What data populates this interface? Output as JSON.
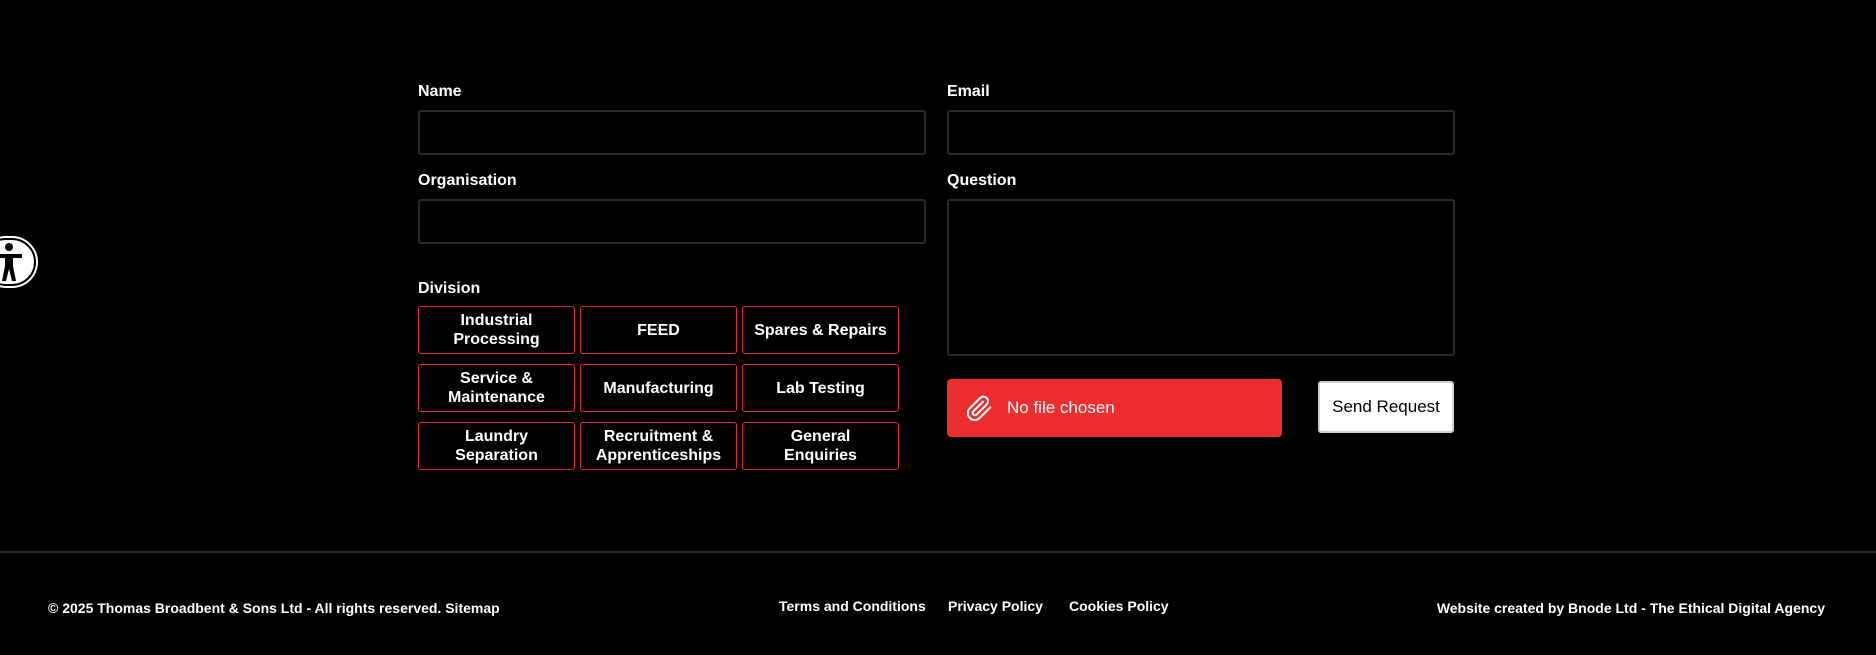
{
  "form": {
    "name_label": "Name",
    "email_label": "Email",
    "organisation_label": "Organisation",
    "question_label": "Question",
    "division_label": "Division",
    "name_value": "",
    "email_value": "",
    "organisation_value": "",
    "question_value": "",
    "divisions": [
      "Industrial Processing",
      "FEED",
      "Spares & Repairs",
      "Service & Maintenance",
      "Manufacturing",
      "Lab Testing",
      "Laundry Separation",
      "Recruitment & Apprenticeships",
      "General Enquiries"
    ],
    "file_status": "No file chosen",
    "file_icon": "paperclip-icon",
    "send_label": "Send Request"
  },
  "accessibility": {
    "icon": "accessibility-icon"
  },
  "footer": {
    "copyright": "© 2025 Thomas Broadbent & Sons Ltd - All rights reserved.",
    "sitemap": "Sitemap",
    "links": [
      "Terms and Conditions",
      "Privacy Policy",
      "Cookies Policy"
    ],
    "credit": "Website created by Bnode Ltd - The Ethical Digital Agency"
  },
  "colors": {
    "background": "#000000",
    "accent": "#ee2e2e",
    "division_border": "#e32b2b",
    "field_border": "#2a2a2a"
  }
}
